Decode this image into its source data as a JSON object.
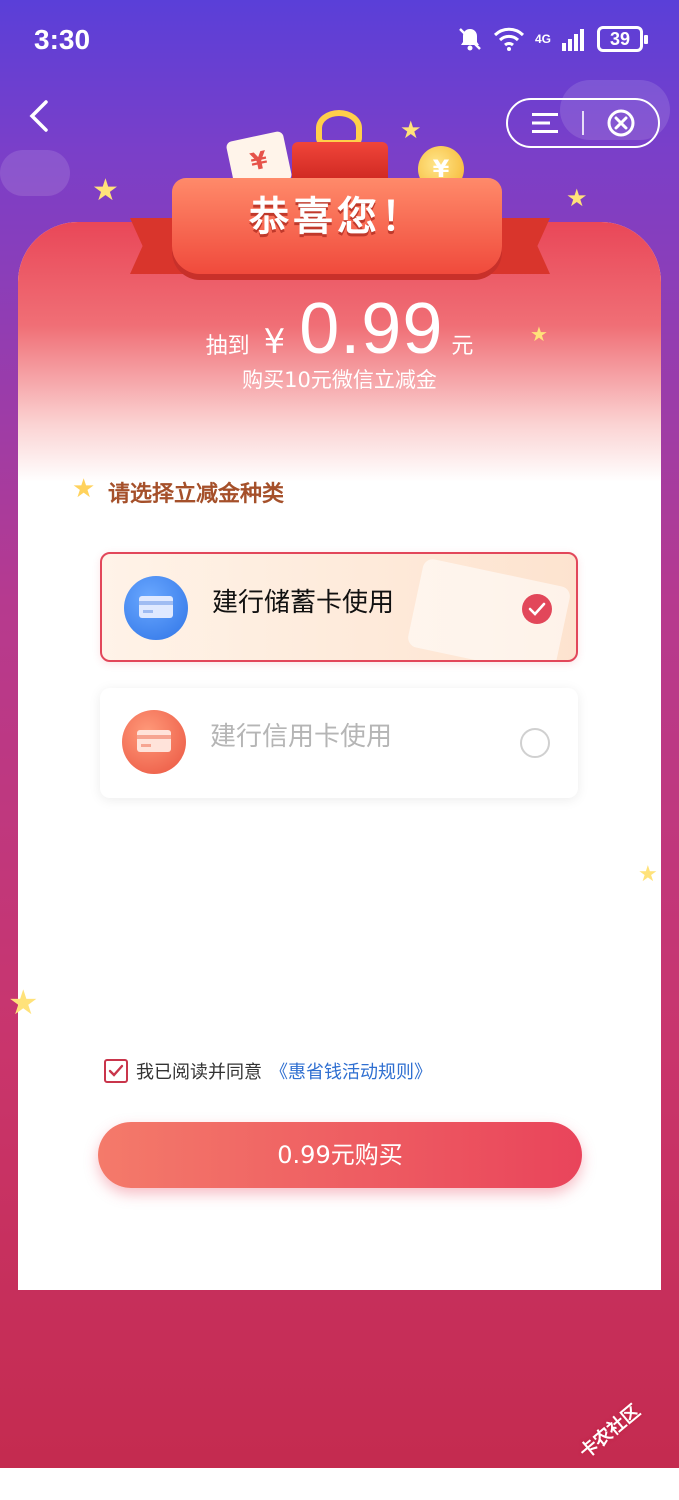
{
  "status_bar": {
    "time": "3:30",
    "network": "4G",
    "battery": "39",
    "icons": [
      "mute-bell-icon",
      "wifi-icon",
      "signal-icon",
      "battery-icon"
    ]
  },
  "nav": {
    "icons": [
      "back-chevron-icon",
      "menu-icon",
      "close-circle-icon"
    ]
  },
  "header": {
    "title": "恭喜您！"
  },
  "prize": {
    "prefix": "抽到",
    "currency": "¥",
    "amount": "0.99",
    "unit": "元",
    "subtitle": "购买10元微信立减金"
  },
  "section": {
    "title": "请选择立减金种类"
  },
  "options": [
    {
      "label": "建行储蓄卡使用",
      "selected": true,
      "icon": "blue-card-icon"
    },
    {
      "label": "建行信用卡使用",
      "selected": false,
      "icon": "red-card-icon"
    }
  ],
  "agreement": {
    "checked": true,
    "text": "我已阅读并同意",
    "link": "《惠省钱活动规则》"
  },
  "buy_button": {
    "label": "0.99元购买"
  },
  "watermark": "卡农社区",
  "colors": {
    "accent": "#e2475a",
    "section_title": "#a5502a",
    "link": "#2f6fd1"
  }
}
